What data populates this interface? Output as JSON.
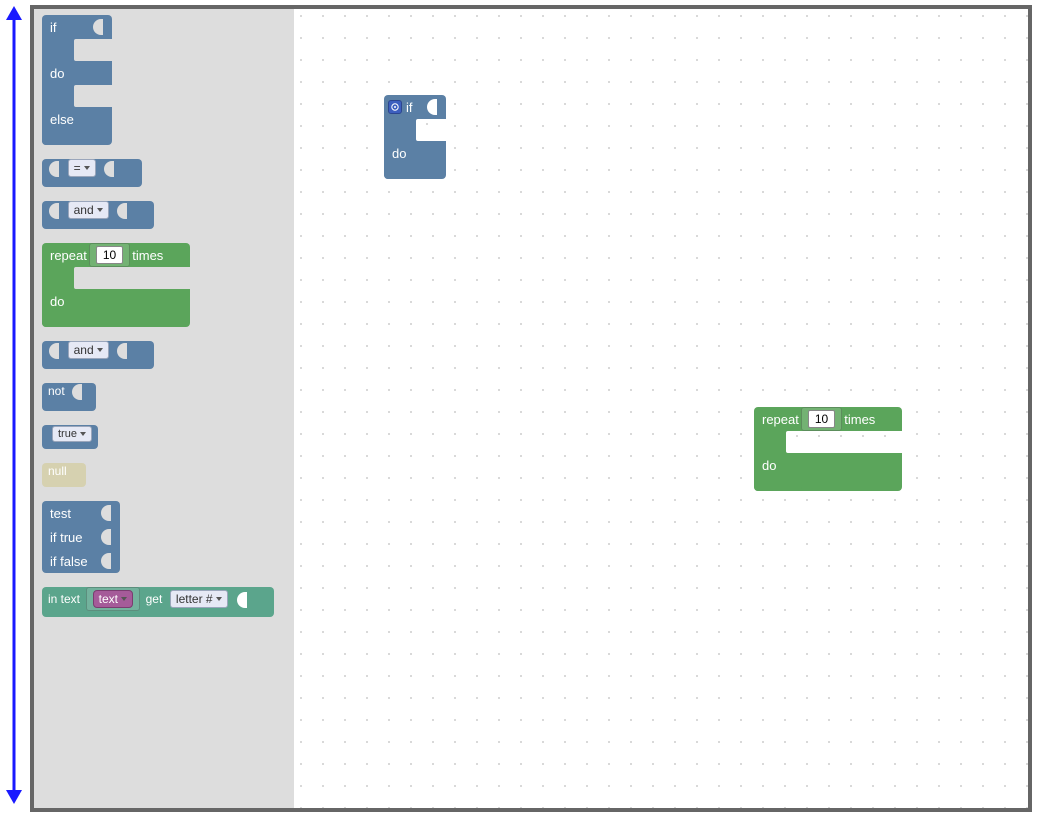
{
  "colors": {
    "logic": "#5b80a5",
    "loop": "#5ba55b",
    "null_block": "#d6d1b0",
    "text": "#5ba58c",
    "variable": "#a55b99",
    "arrow": "#1a1aff",
    "border": "#666666"
  },
  "toolbox": {
    "if_do_else": {
      "if": "if",
      "do": "do",
      "else": "else"
    },
    "compare": {
      "op": "="
    },
    "logic_and_1": {
      "op": "and"
    },
    "repeat": {
      "repeat": "repeat",
      "count": "10",
      "times": "times",
      "do": "do"
    },
    "logic_and_2": {
      "op": "and"
    },
    "not": {
      "label": "not"
    },
    "true": {
      "label": "true"
    },
    "null": {
      "label": "null"
    },
    "test": {
      "test": "test",
      "iftrue": "if true",
      "iffalse": "if false"
    },
    "text_get": {
      "intext": "in text",
      "var": "text",
      "get": "get",
      "mode": "letter #"
    }
  },
  "workspace": {
    "if_block": {
      "if": "if",
      "do": "do"
    },
    "repeat_block": {
      "repeat": "repeat",
      "count": "10",
      "times": "times",
      "do": "do"
    }
  }
}
